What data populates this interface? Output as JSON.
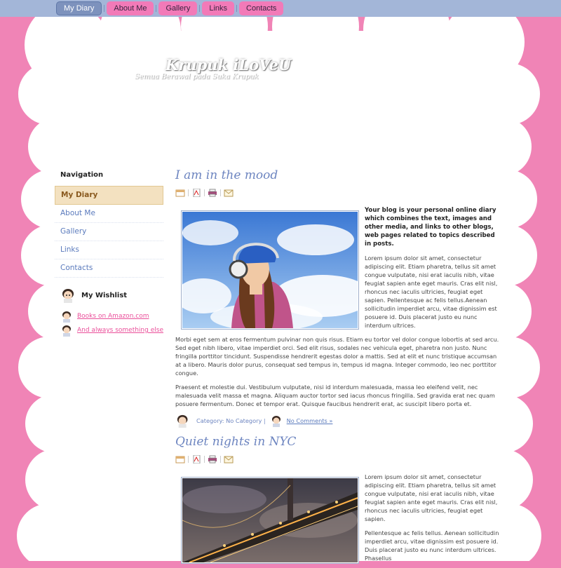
{
  "topnav": {
    "items": [
      {
        "label": "My Diary",
        "active": true
      },
      {
        "label": "About Me",
        "active": false
      },
      {
        "label": "Gallery",
        "active": false
      },
      {
        "label": "Links",
        "active": false
      },
      {
        "label": "Contacts",
        "active": false
      }
    ]
  },
  "header": {
    "title": "Krupuk iLoVeU",
    "tagline": "Semua Berawal pada Suka Krupuk"
  },
  "sidebar": {
    "heading": "Navigation",
    "items": [
      {
        "label": "My Diary",
        "active": true
      },
      {
        "label": "About Me",
        "active": false
      },
      {
        "label": "Gallery",
        "active": false
      },
      {
        "label": "Links",
        "active": false
      },
      {
        "label": "Contacts",
        "active": false
      }
    ],
    "wishlist_heading": "My Wishlist",
    "wishlist": [
      {
        "label": "Books on Amazon.com"
      },
      {
        "label": "And always something else"
      }
    ]
  },
  "posts": [
    {
      "title": "I am in the mood",
      "intro": "Your blog is your personal online diary which combines the text, images and other media, and links to other blogs, web pages related to topics described in posts.",
      "paragraphs": [
        "Lorem ipsum dolor sit amet, consectetur adipiscing elit. Etiam pharetra, tellus sit amet congue vulputate, nisi erat iaculis nibh, vitae feugiat sapien ante eget mauris. Cras elit nisl, rhoncus nec iaculis ultricies, feugiat eget sapien. Pellentesque ac felis tellus.Aenean sollicitudin imperdiet arcu, vitae dignissim est posuere id. Duis placerat justo eu nunc interdum ultrices.",
        "Morbi eget sem at eros fermentum pulvinar non quis risus. Etiam eu tortor vel dolor congue lobortis at sed arcu. Sed eget nibh libero, vitae imperdiet orci. Sed elit risus, sodales nec vehicula eget, pharetra non justo. Nunc fringilla porttitor tincidunt. Suspendisse hendrerit egestas dolor a mattis. Sed at elit et nunc tristique accumsan at a libero. Mauris dolor purus, consequat sed tempus in, tempus id magna. Integer commodo, leo nec porttitor congue.",
        "Praesent et molestie dui. Vestibulum vulputate, nisi id interdum malesuada, massa leo eleifend velit, nec malesuada velit massa et magna. Aliquam auctor tortor sed iacus rhoncus fringilla. Sed gravida erat nec quam posuere fermentum. Donec et tempor erat. Quisque faucibus hendrerit erat, ac suscipit libero porta et."
      ],
      "category_text": "Category: No Category |",
      "comments": "No Comments »"
    },
    {
      "title": "Quiet nights in NYC",
      "paragraphs": [
        "Lorem ipsum dolor sit amet, consectetur adipiscing elit. Etiam pharetra, tellus sit amet congue vulputate, nisi erat iaculis nibh, vitae feugiat sapien ante eget mauris. Cras elit nisl, rhoncus nec iaculis ultricies, feugiat eget sapien.",
        "Pellentesque ac felis tellus. Aenean sollicitudin imperdiet arcu, vitae dignissim est posuere id. Duis placerat justo eu nunc interdum ultrices. Phasellus"
      ]
    }
  ],
  "colors": {
    "background": "#f084b6",
    "topbar": "#a3b6d8",
    "nav_button": "#f27ab8",
    "nav_active": "#7d92bd",
    "link": "#5b7bbd",
    "title": "#6d85c0"
  },
  "icons": [
    "calendar-icon",
    "pdf-icon",
    "print-icon",
    "email-icon",
    "avatar-icon"
  ]
}
